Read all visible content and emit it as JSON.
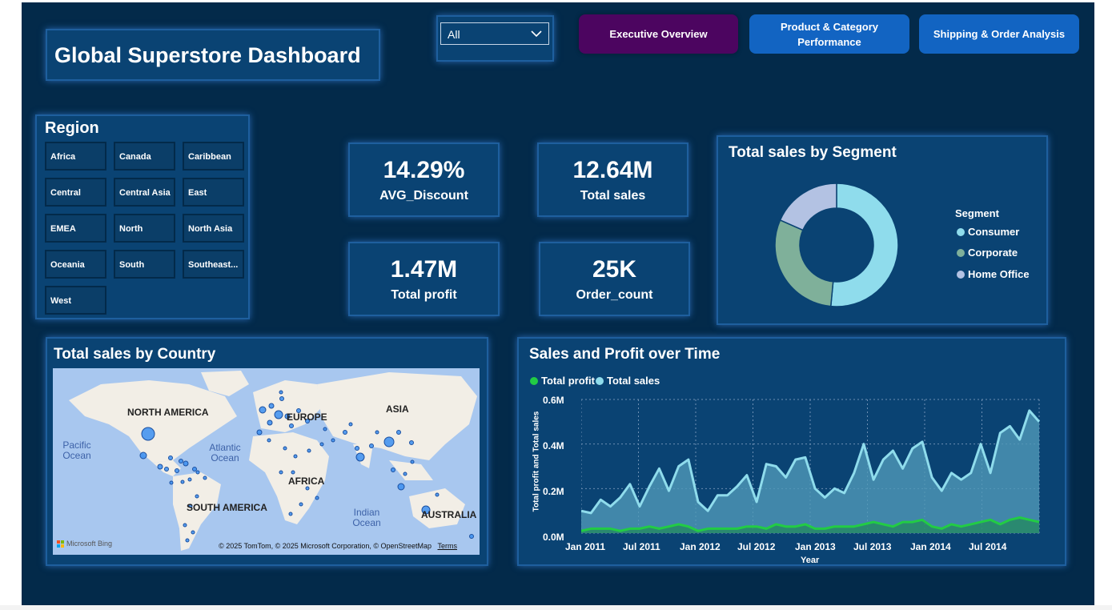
{
  "header": {
    "title": "Global Superstore Dashboard",
    "filter_value": "All",
    "nav": [
      "Executive Overview",
      "Product & Category Performance",
      "Shipping & Order Analysis"
    ]
  },
  "region": {
    "title": "Region",
    "items": [
      "Africa",
      "Canada",
      "Caribbean",
      "Central",
      "Central Asia",
      "East",
      "EMEA",
      "North",
      "North Asia",
      "Oceania",
      "South",
      "Southeast...",
      "West"
    ]
  },
  "kpis": {
    "avg_discount": {
      "value": "14.29%",
      "label": "AVG_Discount"
    },
    "total_sales": {
      "value": "12.64M",
      "label": "Total sales"
    },
    "total_profit": {
      "value": "1.47M",
      "label": "Total profit"
    },
    "order_count": {
      "value": "25K",
      "label": "Order_count"
    }
  },
  "segment_chart": {
    "title": "Total sales by Segment",
    "legend_title": "Segment"
  },
  "map": {
    "title": "Total sales by Country",
    "continents": [
      "NORTH AMERICA",
      "EUROPE",
      "ASIA",
      "AFRICA",
      "SOUTH AMERICA",
      "AUSTRALIA"
    ],
    "oceans": [
      "Pacific Ocean",
      "Atlantic Ocean",
      "Indian Ocean"
    ],
    "attribution": "© 2025 TomTom, © 2025 Microsoft Corporation, © OpenStreetMap",
    "terms": "Terms",
    "provider": "Microsoft Bing"
  },
  "line_chart": {
    "title": "Sales and Profit over Time",
    "xlabel": "Year",
    "ylabel": "Total profit and Total sales",
    "y_ticks": [
      "0.6M",
      "0.4M",
      "0.2M",
      "0.0M"
    ],
    "x_ticks": [
      "Jan 2011",
      "Jul 2011",
      "Jan 2012",
      "Jul 2012",
      "Jan 2013",
      "Jul 2013",
      "Jan 2014",
      "Jul 2014"
    ]
  },
  "colors": {
    "consumer": "#8fdcec",
    "corporate": "#7fb09a",
    "home_office": "#b3c2e3",
    "sales_line": "#8fdcec",
    "profit_line": "#22cc44",
    "exec_button": "#4c0560",
    "nav_button": "#1264c2"
  },
  "chart_data": [
    {
      "type": "pie",
      "title": "Total sales by Segment",
      "categories": [
        "Consumer",
        "Corporate",
        "Home Office"
      ],
      "values": [
        51.5,
        30.1,
        18.4
      ]
    },
    {
      "type": "line",
      "title": "Sales and Profit over Time",
      "xlabel": "Year",
      "ylabel": "Total profit and Total sales",
      "ylim": [
        0,
        0.6
      ],
      "y_unit": "M",
      "x_start": "Jan 2011",
      "x_end": "Dec 2014",
      "series": [
        {
          "name": "Total profit",
          "values": [
            0.01,
            0.02,
            0.02,
            0.02,
            0.01,
            0.02,
            0.02,
            0.03,
            0.02,
            0.03,
            0.04,
            0.03,
            0.01,
            0.02,
            0.02,
            0.02,
            0.02,
            0.03,
            0.03,
            0.02,
            0.04,
            0.03,
            0.03,
            0.04,
            0.02,
            0.02,
            0.03,
            0.03,
            0.03,
            0.04,
            0.05,
            0.04,
            0.03,
            0.05,
            0.05,
            0.06,
            0.03,
            0.02,
            0.04,
            0.03,
            0.04,
            0.05,
            0.06,
            0.04,
            0.06,
            0.07,
            0.06,
            0.05
          ]
        },
        {
          "name": "Total sales",
          "values": [
            0.1,
            0.09,
            0.15,
            0.12,
            0.16,
            0.22,
            0.12,
            0.21,
            0.29,
            0.19,
            0.3,
            0.33,
            0.14,
            0.1,
            0.17,
            0.17,
            0.21,
            0.26,
            0.14,
            0.31,
            0.3,
            0.25,
            0.33,
            0.34,
            0.2,
            0.16,
            0.2,
            0.18,
            0.27,
            0.4,
            0.24,
            0.33,
            0.37,
            0.29,
            0.38,
            0.41,
            0.25,
            0.19,
            0.27,
            0.24,
            0.27,
            0.4,
            0.27,
            0.45,
            0.48,
            0.42,
            0.55,
            0.5
          ]
        }
      ]
    }
  ]
}
